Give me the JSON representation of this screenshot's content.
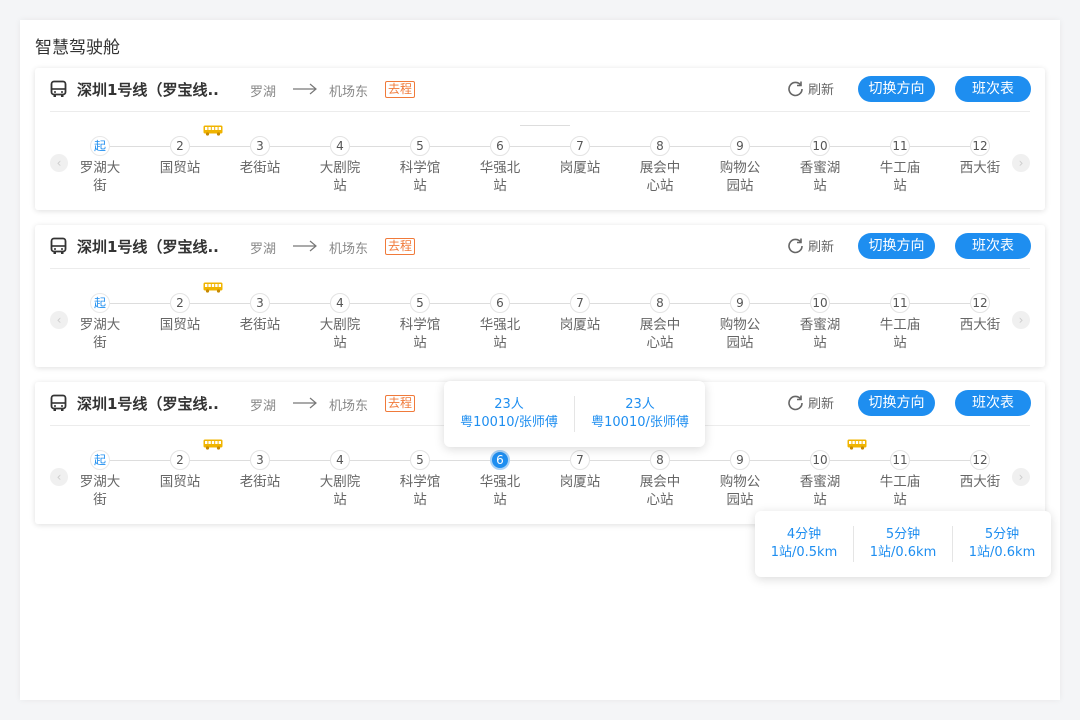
{
  "page": {
    "title": "智慧驾驶舱"
  },
  "colors": {
    "accent": "#1e8ef0",
    "bus": "#f0b400",
    "direction_badge": "#f07a3a"
  },
  "icons": {
    "line": "bus-front-icon",
    "route_arrow": "long-arrow-right-icon",
    "refresh": "refresh-icon",
    "bus_marker": "bus-side-icon",
    "prev": "chevron-left-icon",
    "next": "chevron-right-icon"
  },
  "cards": [
    {
      "line_name": "深圳1号线（罗宝线..",
      "from": "罗湖",
      "to": "机场东",
      "direction_badge": "去程",
      "refresh_label": "刷新",
      "switch_label": "切换方向",
      "schedule_label": "班次表",
      "stations": [
        {
          "num": "起",
          "name": "罗湖大街"
        },
        {
          "num": "2",
          "name": "国贸站"
        },
        {
          "num": "3",
          "name": "老街站"
        },
        {
          "num": "4",
          "name": "大剧院站"
        },
        {
          "num": "5",
          "name": "科学馆站"
        },
        {
          "num": "6",
          "name": "华强北站"
        },
        {
          "num": "7",
          "name": "岗厦站"
        },
        {
          "num": "8",
          "name": "展会中心站"
        },
        {
          "num": "9",
          "name": "购物公园站"
        },
        {
          "num": "10",
          "name": "香蜜湖站"
        },
        {
          "num": "11",
          "name": "牛工庙站"
        },
        {
          "num": "12",
          "name": "西大街"
        }
      ]
    },
    {
      "line_name": "深圳1号线（罗宝线..",
      "from": "罗湖",
      "to": "机场东",
      "direction_badge": "去程",
      "refresh_label": "刷新",
      "switch_label": "切换方向",
      "schedule_label": "班次表",
      "stations": [
        {
          "num": "起",
          "name": "罗湖大街"
        },
        {
          "num": "2",
          "name": "国贸站"
        },
        {
          "num": "3",
          "name": "老街站"
        },
        {
          "num": "4",
          "name": "大剧院站"
        },
        {
          "num": "5",
          "name": "科学馆站"
        },
        {
          "num": "6",
          "name": "华强北站"
        },
        {
          "num": "7",
          "name": "岗厦站"
        },
        {
          "num": "8",
          "name": "展会中心站"
        },
        {
          "num": "9",
          "name": "购物公园站"
        },
        {
          "num": "10",
          "name": "香蜜湖站"
        },
        {
          "num": "11",
          "name": "牛工庙站"
        },
        {
          "num": "12",
          "name": "西大街"
        }
      ]
    },
    {
      "line_name": "深圳1号线（罗宝线..",
      "from": "罗湖",
      "to": "机场东",
      "direction_badge": "去程",
      "refresh_label": "刷新",
      "switch_label": "切换方向",
      "schedule_label": "班次表",
      "stations": [
        {
          "num": "起",
          "name": "罗湖大街"
        },
        {
          "num": "2",
          "name": "国贸站"
        },
        {
          "num": "3",
          "name": "老街站"
        },
        {
          "num": "4",
          "name": "大剧院站"
        },
        {
          "num": "5",
          "name": "科学馆站"
        },
        {
          "num": "6",
          "name": "华强北站"
        },
        {
          "num": "7",
          "name": "岗厦站"
        },
        {
          "num": "8",
          "name": "展会中心站"
        },
        {
          "num": "9",
          "name": "购物公园站"
        },
        {
          "num": "10",
          "name": "香蜜湖站"
        },
        {
          "num": "11",
          "name": "牛工庙站"
        },
        {
          "num": "12",
          "name": "西大街"
        }
      ],
      "passenger_tooltip": [
        {
          "count": "23人",
          "plate_driver": "粤10010/张师傅"
        },
        {
          "count": "23人",
          "plate_driver": "粤10010/张师傅"
        }
      ],
      "eta_tooltip": [
        {
          "time": "4分钟",
          "dist": "1站/0.5km"
        },
        {
          "time": "5分钟",
          "dist": "1站/0.6km"
        },
        {
          "time": "5分钟",
          "dist": "1站/0.6km"
        }
      ]
    }
  ]
}
